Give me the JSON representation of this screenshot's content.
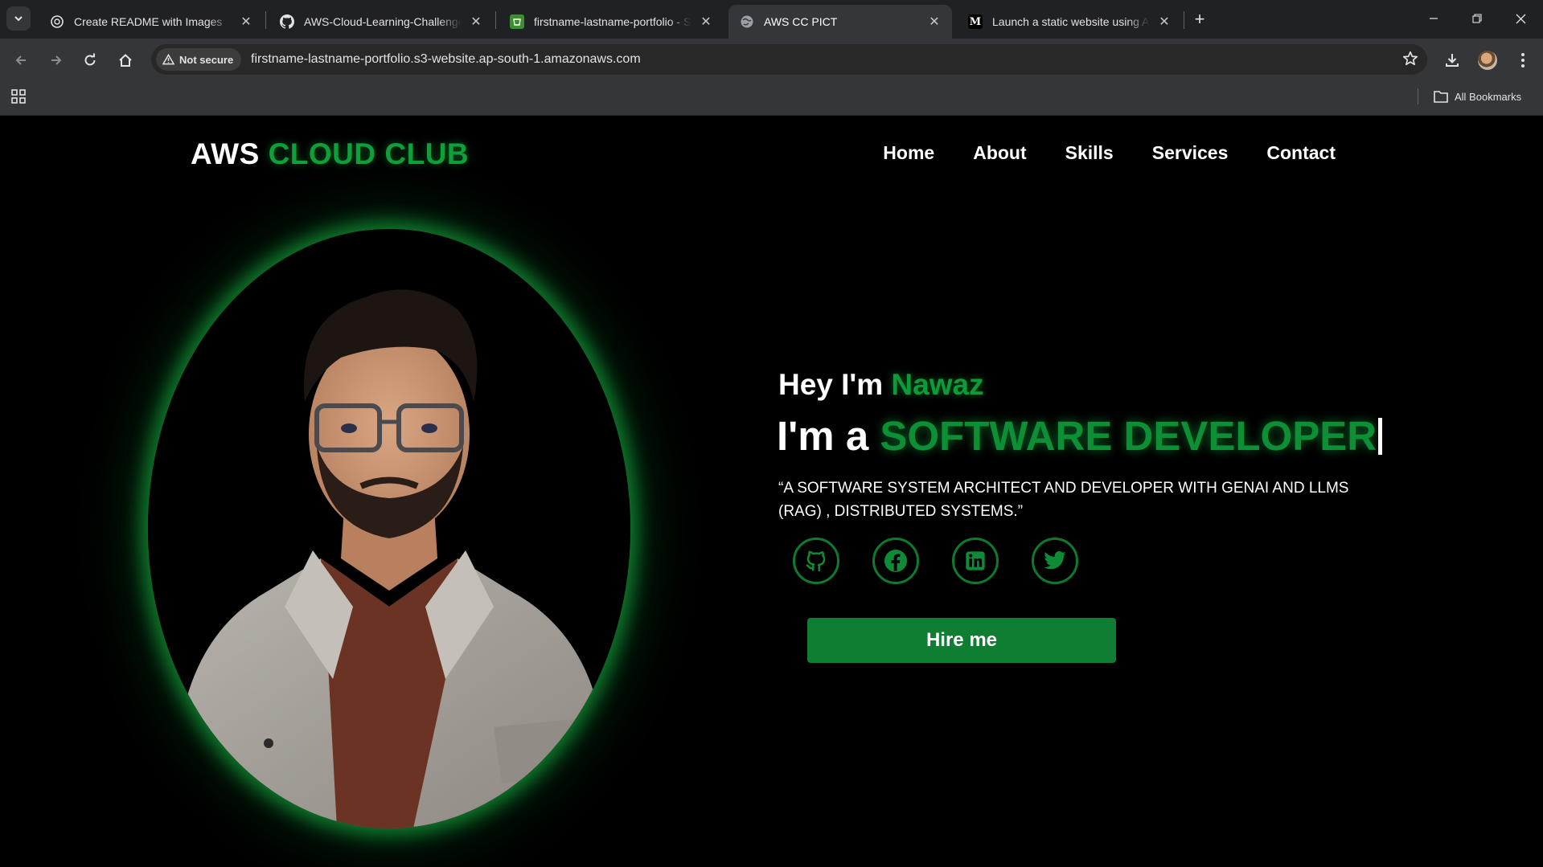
{
  "browser": {
    "tabs": [
      {
        "title": "Create README with Images",
        "icon": "openai-icon"
      },
      {
        "title": "AWS-Cloud-Learning-Challenge",
        "icon": "github-icon"
      },
      {
        "title": "firstname-lastname-portfolio - S",
        "icon": "s3-bucket-icon"
      },
      {
        "title": "AWS CC PICT",
        "icon": "globe-icon"
      },
      {
        "title": "Launch a static website using A",
        "icon": "medium-icon"
      }
    ],
    "active_tab_index": 3,
    "security_label": "Not secure",
    "url": "firstname-lastname-portfolio.s3-website.ap-south-1.amazonaws.com",
    "all_bookmarks_label": "All Bookmarks"
  },
  "page": {
    "logo": {
      "part1": "AWS ",
      "part2": "CLOUD CLUB"
    },
    "nav": [
      "Home",
      "About",
      "Skills",
      "Services",
      "Contact"
    ],
    "hero": {
      "greeting_prefix": "Hey I'm ",
      "name": "Nawaz",
      "role_prefix": "I'm a ",
      "role": "SOFTWARE DEVELOPER",
      "tagline": "“A SOFTWARE SYSTEM ARCHITECT AND DEVELOPER WITH GENAI AND LLMS (RAG) , DISTRIBUTED SYSTEMS.”",
      "socials": [
        "github-icon",
        "facebook-icon",
        "linkedin-icon",
        "twitter-icon"
      ],
      "cta": "Hire me"
    },
    "colors": {
      "accent": "#0ea03b",
      "button": "#0f7e33",
      "background": "#000000"
    }
  }
}
